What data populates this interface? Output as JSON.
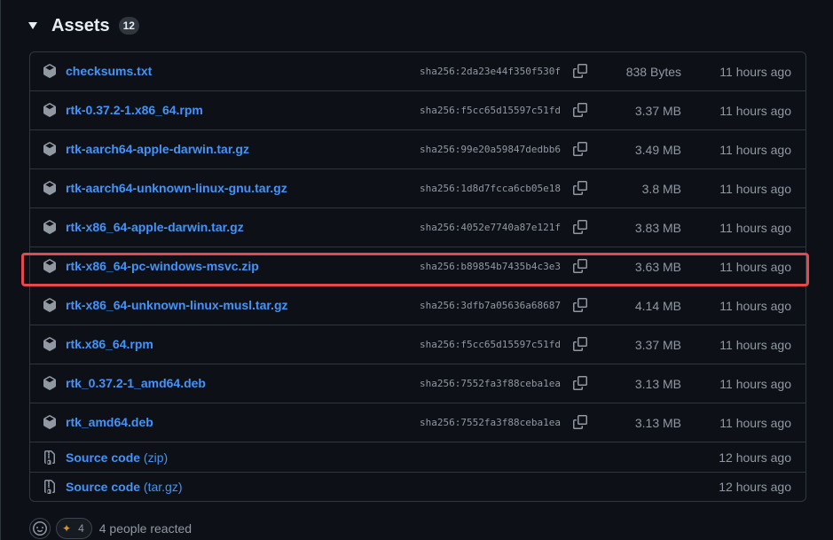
{
  "header": {
    "title": "Assets",
    "count": "12"
  },
  "assets": [
    {
      "name": "checksums.txt",
      "hash": "sha256:2da23e44f350f530f",
      "size": "838 Bytes",
      "time": "11 hours ago"
    },
    {
      "name": "rtk-0.37.2-1.x86_64.rpm",
      "hash": "sha256:f5cc65d15597c51fd",
      "size": "3.37 MB",
      "time": "11 hours ago"
    },
    {
      "name": "rtk-aarch64-apple-darwin.tar.gz",
      "hash": "sha256:99e20a59847dedbb6",
      "size": "3.49 MB",
      "time": "11 hours ago"
    },
    {
      "name": "rtk-aarch64-unknown-linux-gnu.tar.gz",
      "hash": "sha256:1d8d7fcca6cb05e18",
      "size": "3.8 MB",
      "time": "11 hours ago"
    },
    {
      "name": "rtk-x86_64-apple-darwin.tar.gz",
      "hash": "sha256:4052e7740a87e121f",
      "size": "3.83 MB",
      "time": "11 hours ago"
    },
    {
      "name": "rtk-x86_64-pc-windows-msvc.zip",
      "hash": "sha256:b89854b7435b4c3e3",
      "size": "3.63 MB",
      "time": "11 hours ago"
    },
    {
      "name": "rtk-x86_64-unknown-linux-musl.tar.gz",
      "hash": "sha256:3dfb7a05636a68687",
      "size": "4.14 MB",
      "time": "11 hours ago"
    },
    {
      "name": "rtk.x86_64.rpm",
      "hash": "sha256:f5cc65d15597c51fd",
      "size": "3.37 MB",
      "time": "11 hours ago"
    },
    {
      "name": "rtk_0.37.2-1_amd64.deb",
      "hash": "sha256:7552fa3f88ceba1ea",
      "size": "3.13 MB",
      "time": "11 hours ago"
    },
    {
      "name": "rtk_amd64.deb",
      "hash": "sha256:7552fa3f88ceba1ea",
      "size": "3.13 MB",
      "time": "11 hours ago"
    }
  ],
  "source": [
    {
      "label": "Source code",
      "format": "(zip)",
      "time": "12 hours ago"
    },
    {
      "label": "Source code",
      "format": "(tar.gz)",
      "time": "12 hours ago"
    }
  ],
  "reactions": {
    "tada_count": "4",
    "summary": "4 people reacted"
  },
  "colors": {
    "link": "#4493f8",
    "highlight": "#e5484d"
  }
}
